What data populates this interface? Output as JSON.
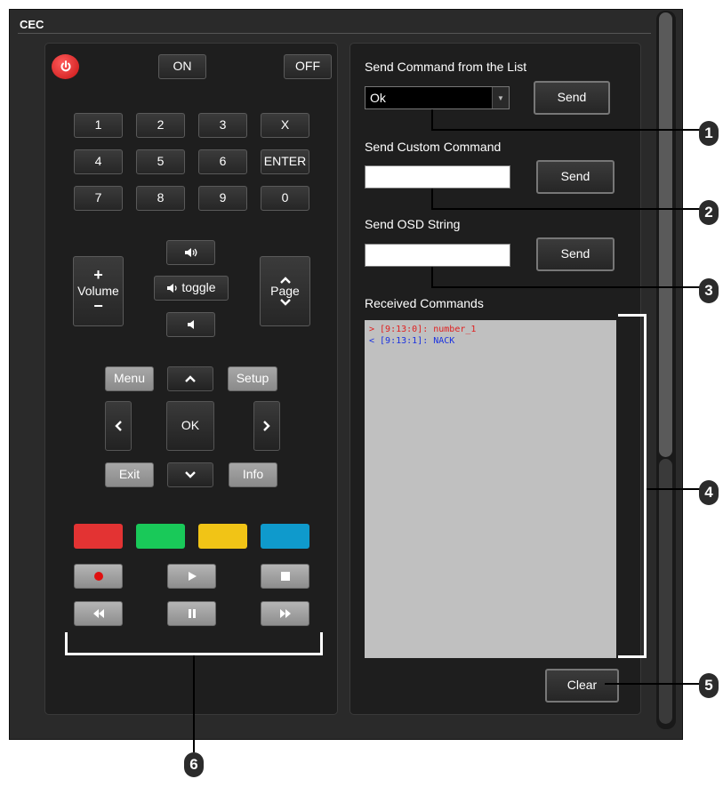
{
  "title": "CEC",
  "power_icon": "power-icon",
  "remote": {
    "on": "ON",
    "off": "OFF",
    "keypad": [
      "1",
      "2",
      "3",
      "X",
      "4",
      "5",
      "6",
      "ENTER",
      "7",
      "8",
      "9",
      "0"
    ],
    "volume_label": "Volume",
    "page_label": "Page",
    "plus": "+",
    "minus": "−",
    "vol_toggle": "toggle",
    "menu": "Menu",
    "setup": "Setup",
    "ok": "OK",
    "exit": "Exit",
    "info": "Info",
    "color_buttons": [
      "#e33333",
      "#19c959",
      "#f1c416",
      "#0f9acc"
    ]
  },
  "right": {
    "list_label": "Send Command from the List",
    "list_value": "Ok",
    "send": "Send",
    "custom_label": "Send Custom Command",
    "osd_label": "Send OSD String",
    "received_label": "Received Commands",
    "log": [
      {
        "text": "> [9:13:0]: number_1",
        "color": "#e02020"
      },
      {
        "text": "< [9:13:1]: NACK",
        "color": "#1a32e0"
      }
    ],
    "clear": "Clear"
  },
  "callouts": [
    "1",
    "2",
    "3",
    "4",
    "5",
    "6"
  ]
}
